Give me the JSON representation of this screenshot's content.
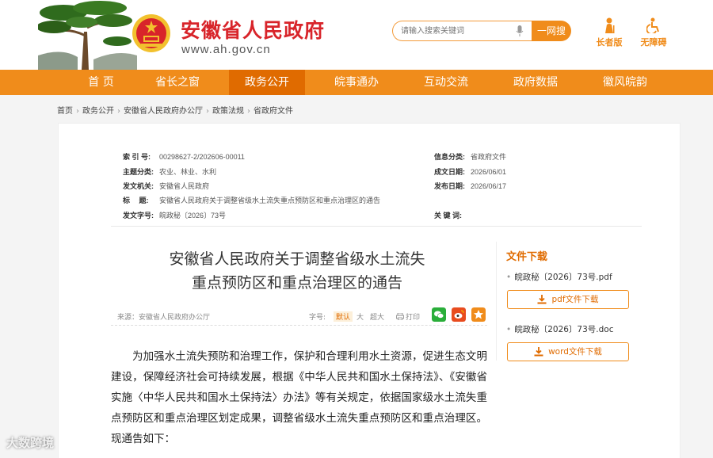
{
  "header": {
    "site_title": "安徽省人民政府",
    "site_domain": "www.ah.gov.cn",
    "search_placeholder": "请输入搜索关键词",
    "search_button": "一网搜",
    "tools": [
      {
        "label": "长者版",
        "icon": "elder-icon"
      },
      {
        "label": "无障碍",
        "icon": "accessibility-icon"
      }
    ],
    "brand_color": "#f08c1b",
    "title_color": "#d8242a"
  },
  "nav": {
    "items": [
      "首 页",
      "省长之窗",
      "政务公开",
      "皖事通办",
      "互动交流",
      "政府数据",
      "徽风皖韵"
    ],
    "active": "政务公开"
  },
  "breadcrumb": [
    "首页",
    "政务公开",
    "安徽省人民政府办公厅",
    "政策法规",
    "省政府文件"
  ],
  "meta": {
    "index_label": "索 引 号:",
    "index_value": "00298627-2/202606-00011",
    "category_label": "信息分类:",
    "category_value": "省政府文件",
    "topic_label": "主题分类:",
    "topic_value": "农业、林业、水利",
    "created_label": "成文日期:",
    "created_value": "2026/06/01",
    "issuer_label": "发文机关:",
    "issuer_value": "安徽省人民政府",
    "published_label": "发布日期:",
    "published_value": "2026/06/17",
    "title_label": "标　 题:",
    "title_value": "安徽省人民政府关于调整省级水土流失重点预防区和重点治理区的通告",
    "docno_label": "发文字号:",
    "docno_value": "皖政秘〔2026〕73号",
    "keywords_label": "关 键 词:",
    "keywords_value": ""
  },
  "document": {
    "title_line1": "安徽省人民政府关于调整省级水土流失",
    "title_line2": "重点预防区和重点治理区的通告",
    "source": "来源：安徽省人民政府办公厅",
    "font_size_label": "字号:",
    "font_sizes": [
      "默认",
      "大",
      "超大"
    ],
    "print_label": "打印",
    "body": "为加强水土流失预防和治理工作，保护和合理利用水土资源，促进生态文明建设，保障经济社会可持续发展，根据《中华人民共和国水土保持法》、《安徽省实施〈中华人民共和国水土保持法〉办法》等有关规定，依据国家级水土流失重点预防区和重点治理区划定成果，调整省级水土流失重点预防区和重点治理区。现通告如下："
  },
  "downloads": {
    "title": "文件下载",
    "files": [
      {
        "name": "皖政秘〔2026〕73号.pdf",
        "button": "pdf文件下载"
      },
      {
        "name": "皖政秘〔2026〕73号.doc",
        "button": "word文件下载"
      }
    ]
  },
  "watermark": "大数跨境"
}
